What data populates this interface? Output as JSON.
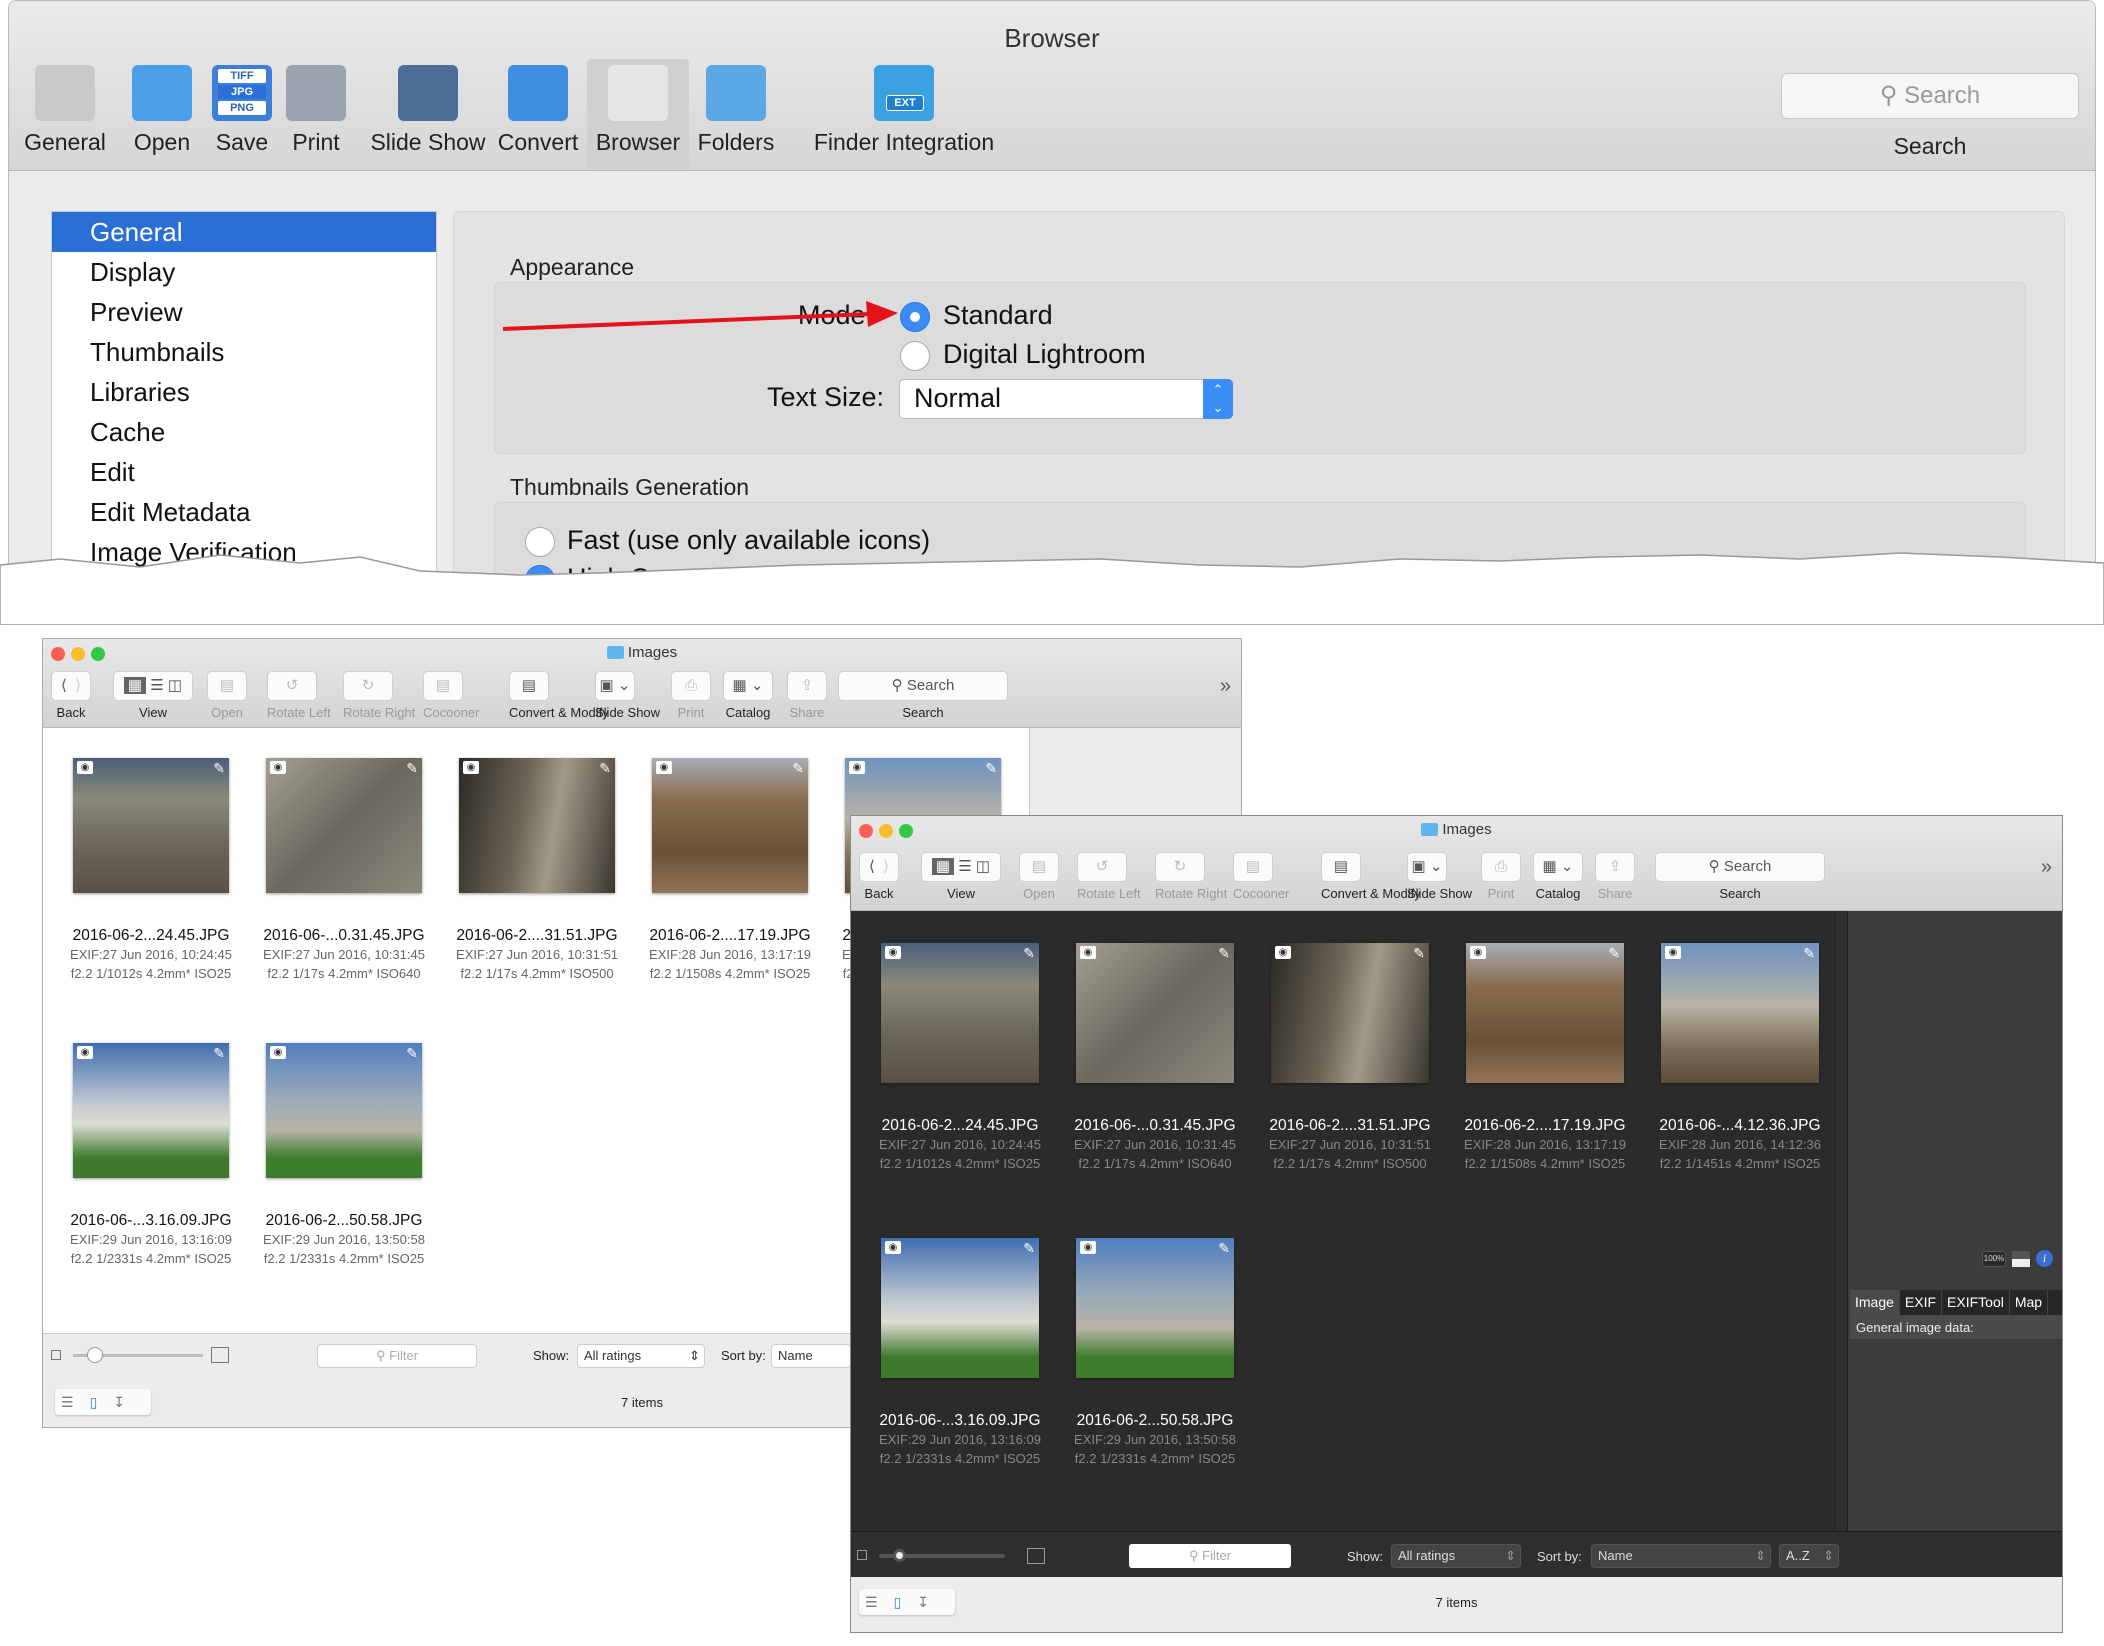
{
  "prefs": {
    "title": "Browser",
    "toolbar": [
      {
        "label": "General",
        "icon": "general-icon",
        "color": "#c9c9c9"
      },
      {
        "label": "Open",
        "icon": "open-folder-icon",
        "color": "#4a9fe8"
      },
      {
        "label": "Save",
        "icon": "save-formats-icon",
        "color": "#3d7fd9",
        "badges": [
          "TIFF",
          "JPG",
          "PNG"
        ]
      },
      {
        "label": "Print",
        "icon": "printer-icon",
        "color": "#9aa4b0"
      },
      {
        "label": "Slide Show",
        "icon": "slideshow-icon",
        "color": "#4a6e96"
      },
      {
        "label": "Convert",
        "icon": "convert-icon",
        "color": "#3e8fe0"
      },
      {
        "label": "Browser",
        "icon": "browser-icon",
        "color": "#e6e6e6",
        "selected": true
      },
      {
        "label": "Folders",
        "icon": "folders-icon",
        "color": "#5aa8e6"
      },
      {
        "label": "Finder Integration",
        "icon": "finder-ext-icon",
        "color": "#3aa0e0",
        "badge": "EXT"
      }
    ],
    "search_placeholder": "Search",
    "search_label": "Search",
    "sidebar": [
      "General",
      "Display",
      "Preview",
      "Thumbnails",
      "Libraries",
      "Cache",
      "Edit",
      "Edit Metadata",
      "Image Verification"
    ],
    "sidebar_selected": "General",
    "appearance": {
      "title": "Appearance",
      "mode_label": "Mode:",
      "mode_options": [
        "Standard",
        "Digital Lightroom"
      ],
      "mode_selected": "Standard",
      "text_size_label": "Text Size:",
      "text_size_value": "Normal"
    },
    "thumbnails_generation": {
      "title": "Thumbnails Generation",
      "options": [
        "Fast (use only available icons)",
        "High Q"
      ]
    },
    "annotation_arrow_color": "#e3121b"
  },
  "browser": {
    "title": "Images",
    "toolbar": [
      {
        "label": "Back",
        "icon": "back-forward-icon",
        "enabled": true
      },
      {
        "label": "View",
        "icon": "view-mode-icon",
        "enabled": true
      },
      {
        "label": "Open",
        "icon": "open-icon",
        "enabled": false
      },
      {
        "label": "Rotate Left",
        "icon": "rotate-left-icon",
        "enabled": false
      },
      {
        "label": "Rotate Right",
        "icon": "rotate-right-icon",
        "enabled": false
      },
      {
        "label": "Cocooner",
        "icon": "cocooner-icon",
        "enabled": false
      },
      {
        "label": "Convert & Modify",
        "icon": "convert-modify-icon",
        "enabled": true
      },
      {
        "label": "Slide Show",
        "icon": "slideshow-icon",
        "enabled": true
      },
      {
        "label": "Print",
        "icon": "print-icon",
        "enabled": false
      },
      {
        "label": "Catalog",
        "icon": "catalog-icon",
        "enabled": true
      },
      {
        "label": "Share",
        "icon": "share-icon",
        "enabled": false
      },
      {
        "label": "Search",
        "icon": "search-icon",
        "enabled": true
      }
    ],
    "search_placeholder": "Search",
    "overflow": "»",
    "images": [
      {
        "name": "2016-06-2...24.45.JPG",
        "exif": "EXIF:27 Jun 2016, 10:24:45",
        "info": "f2.2 1/1012s 4.2mm* ISO25",
        "tone": "road"
      },
      {
        "name": "2016-06-...0.31.45.JPG",
        "exif": "EXIF:27 Jun 2016, 10:31:45",
        "info": "f2.2 1/17s 4.2mm* ISO640",
        "tone": "relief"
      },
      {
        "name": "2016-06-2....31.51.JPG",
        "exif": "EXIF:27 Jun 2016, 10:31:51",
        "info": "f2.2 1/17s 4.2mm* ISO500",
        "tone": "arch"
      },
      {
        "name": "2016-06-2....17.19.JPG",
        "exif": "EXIF:28 Jun 2016, 13:17:19",
        "info": "f2.2 1/1508s 4.2mm* ISO25",
        "tone": "colosseum"
      },
      {
        "name": "2016-06-...4.12.36.JPG",
        "exif": "EXIF:28 Jun 2016, 14:12:36",
        "info": "f2.2 1/1451s 4.2mm* ISO25",
        "tone": "forum"
      },
      {
        "name": "2016-06-...3.16.09.JPG",
        "exif": "EXIF:29 Jun 2016, 13:16:09",
        "info": "f2.2 1/2331s 4.2mm* ISO25",
        "tone": "pisa"
      },
      {
        "name": "2016-06-2...50.58.JPG",
        "exif": "EXIF:29 Jun 2016, 13:50:58",
        "info": "f2.2 1/2331s 4.2mm* ISO25",
        "tone": "tower"
      }
    ],
    "filter_placeholder": "Filter",
    "show_label": "Show:",
    "show_value": "All ratings",
    "sort_label": "Sort by:",
    "sort_value": "Name",
    "order_value": "A..Z",
    "items_count": "7 items",
    "info_panel": {
      "zoom_badge": "100%",
      "tabs": [
        "Image",
        "EXIF",
        "EXIFTool",
        "Map"
      ],
      "active_tab": "Image",
      "section": "General image data:"
    }
  }
}
